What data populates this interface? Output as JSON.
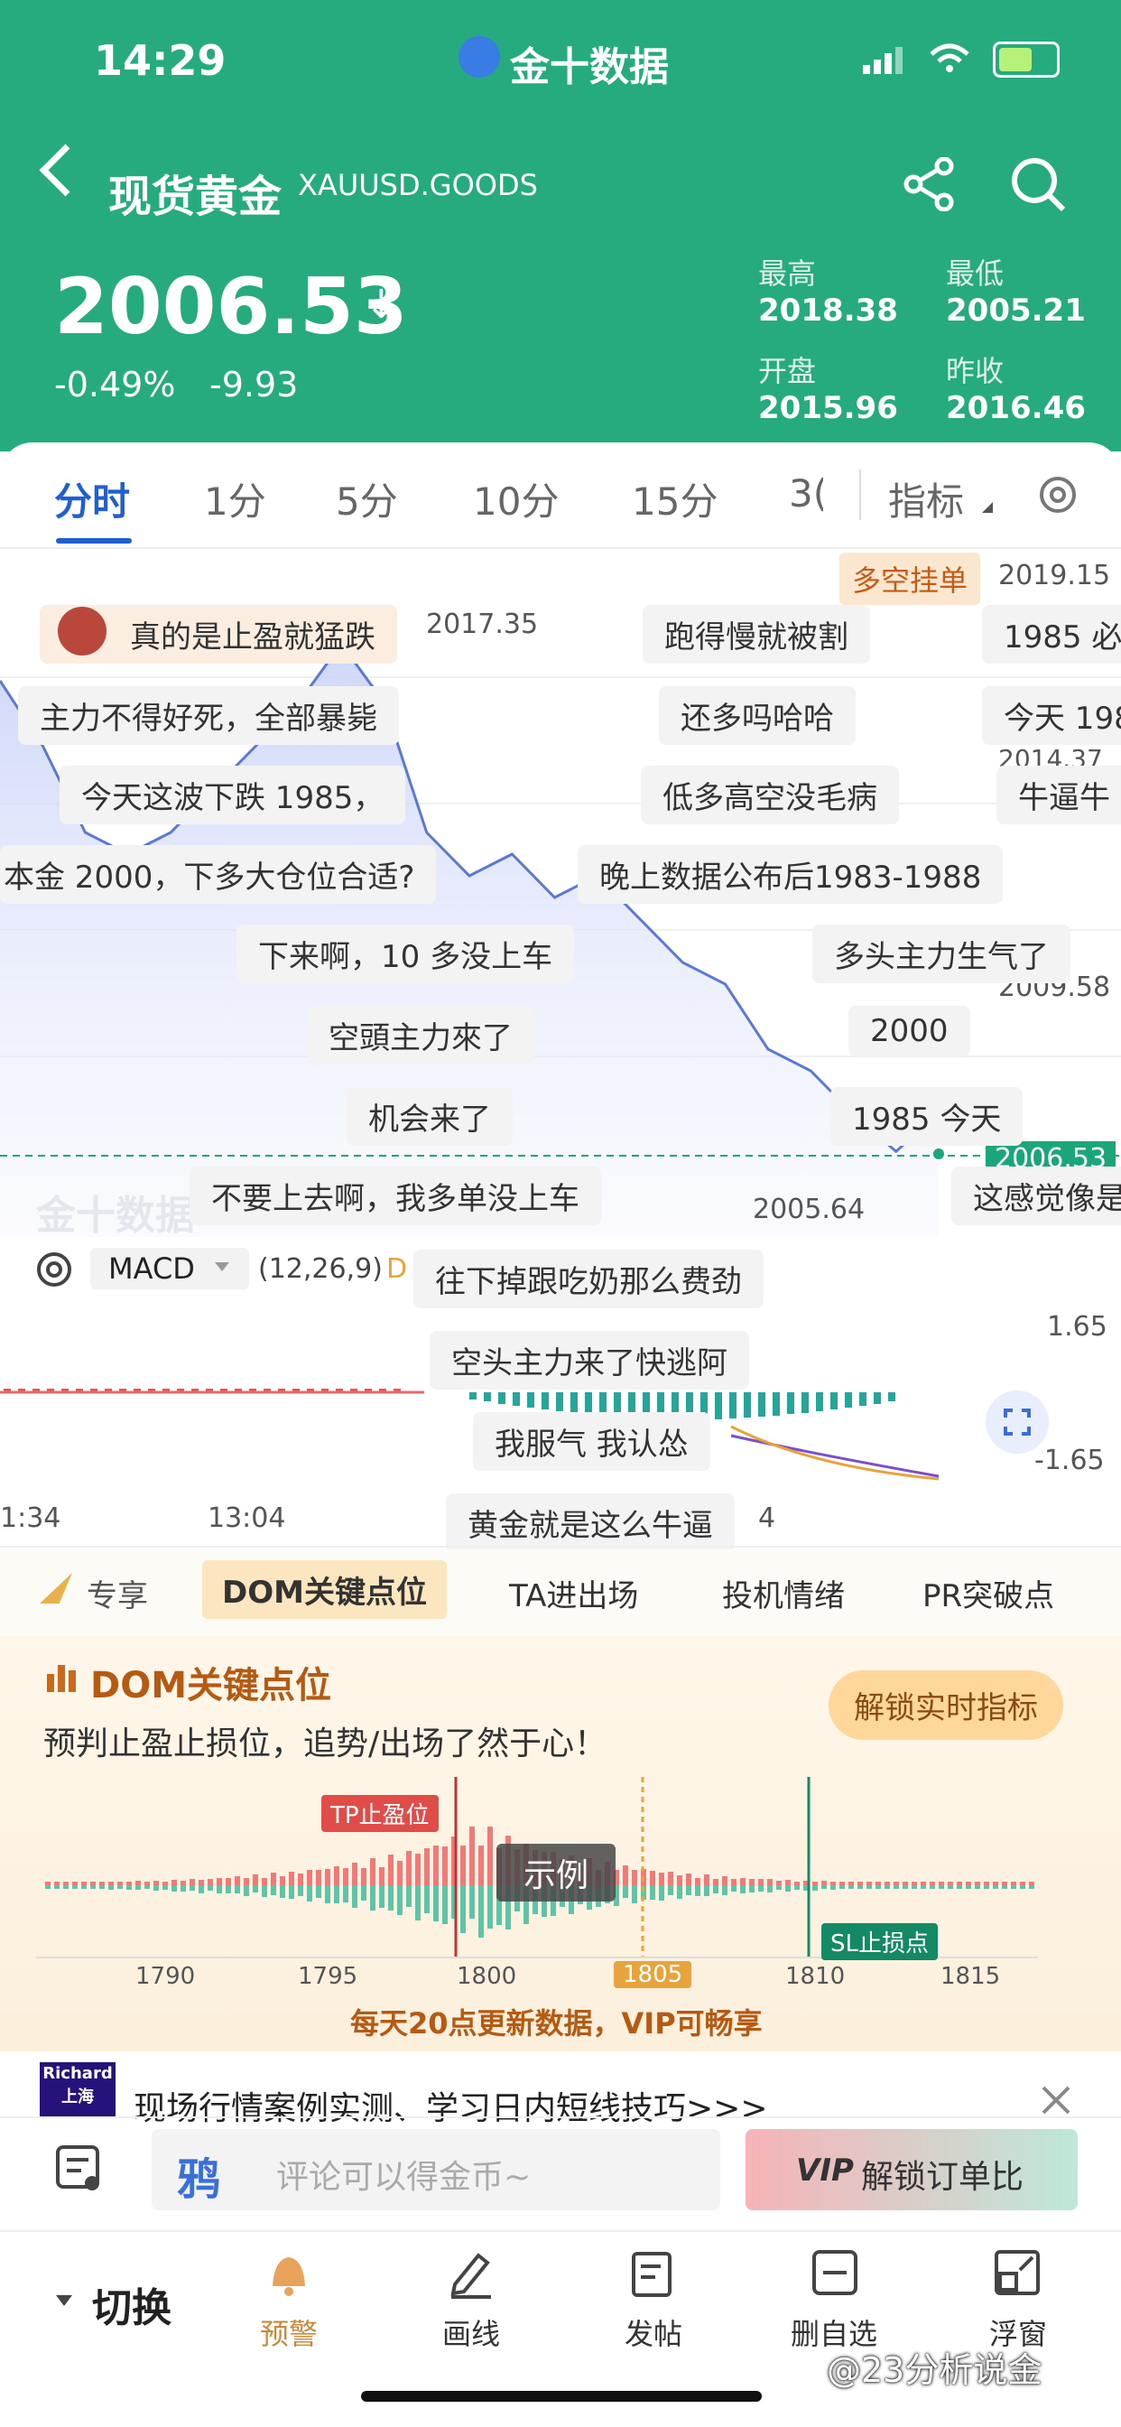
{
  "status": {
    "time": "14:29",
    "app_name": "金十数据"
  },
  "header": {
    "title": "现货黄金",
    "code": "XAUUSD.GOODS",
    "price": "2006.53",
    "change_pct": "-0.49%",
    "change": "-9.93",
    "stats": {
      "high_label": "最高",
      "high": "2018.38",
      "low_label": "最低",
      "low": "2005.21",
      "open_label": "开盘",
      "open": "2015.96",
      "prev_label": "昨收",
      "prev": "2016.46"
    }
  },
  "tabs": [
    "分时",
    "1分",
    "5分",
    "10分",
    "15分",
    "3(",
    "指标"
  ],
  "chart": {
    "long_short_label": "多空挂单",
    "right_top_value": "2019.15",
    "peak_label": "2017.35",
    "low_label": "2005.64",
    "right_mid_value": "2009.58",
    "right_low_value": "2014.37",
    "current_price_tag": "2006.53",
    "watermark": "金十数据",
    "macd": {
      "name": "MACD",
      "params": "(12,26,9)",
      "extra": "D",
      "upper": "1.65",
      "lower": "-1.65"
    },
    "time_labels": [
      "1:34",
      "13:04",
      "4"
    ]
  },
  "comments": [
    "真的是止盈就猛跌",
    "跑得慢就被割",
    "1985 必",
    "主力不得好死，全部暴毙",
    "还多吗哈哈",
    "今天 198",
    "今天这波下跌 1985，",
    "低多高空没毛病",
    "牛逼牛",
    "本金 2000，下多大仓位合适?",
    "晚上数据公布后1983-1988",
    "下来啊，10 多没上车",
    "多头主力生气了",
    "空頭主力來了",
    "2000",
    "机会来了",
    "1985 今天",
    "不要上去啊，我多单没上车",
    "这感觉像是",
    "往下掉跟吃奶那么费劲",
    "空头主力来了快逃阿",
    "我服气 我认怂",
    "黄金就是这么牛逼"
  ],
  "feature_tabs": [
    "专享",
    "DOM关键点位",
    "TA进出场",
    "投机情绪",
    "PR突破点"
  ],
  "dom": {
    "title": "DOM关键点位",
    "subtitle": "预判止盈止损位，追势/出场了然于心！",
    "unlock": "解锁实时指标",
    "tp_label": "TP止盈位",
    "sl_label": "SL止损点",
    "example": "示例",
    "x_labels": [
      "1790",
      "1795",
      "1800",
      "1805",
      "1810",
      "1815"
    ],
    "footer": "每天20点更新数据，VIP可畅享"
  },
  "ad": {
    "badge_top": "Richard",
    "badge_bottom": "上海",
    "text": "现场行情案例实测、学习日内短线技巧>>>"
  },
  "comment_bar": {
    "placeholder": "评论可以得金币~",
    "vip_button": "解锁订单比",
    "vip_badge": "VIP"
  },
  "bottom_nav": {
    "switch": "切换",
    "items": [
      "预警",
      "画线",
      "发帖",
      "删自选",
      "浮窗"
    ]
  },
  "watermark_text": "@23分析说金",
  "chart_data": {
    "type": "line",
    "title": "",
    "series": [
      {
        "name": "",
        "values": [
          2016.5,
          2015,
          2013,
          2012.5,
          2013,
          2014,
          2015,
          2016,
          2017.35,
          2016,
          2013,
          2012,
          2012.5,
          2011.5,
          2012,
          2011,
          2010,
          2009.5,
          2008,
          2007.5,
          2006.5,
          2005.64,
          2006.53
        ]
      }
    ],
    "ylabel": "",
    "xlabel": ""
  },
  "colors": {
    "brand": "#25ab7e",
    "up": "#ef5350",
    "down": "#26a69a",
    "accent": "#e7a33c"
  }
}
